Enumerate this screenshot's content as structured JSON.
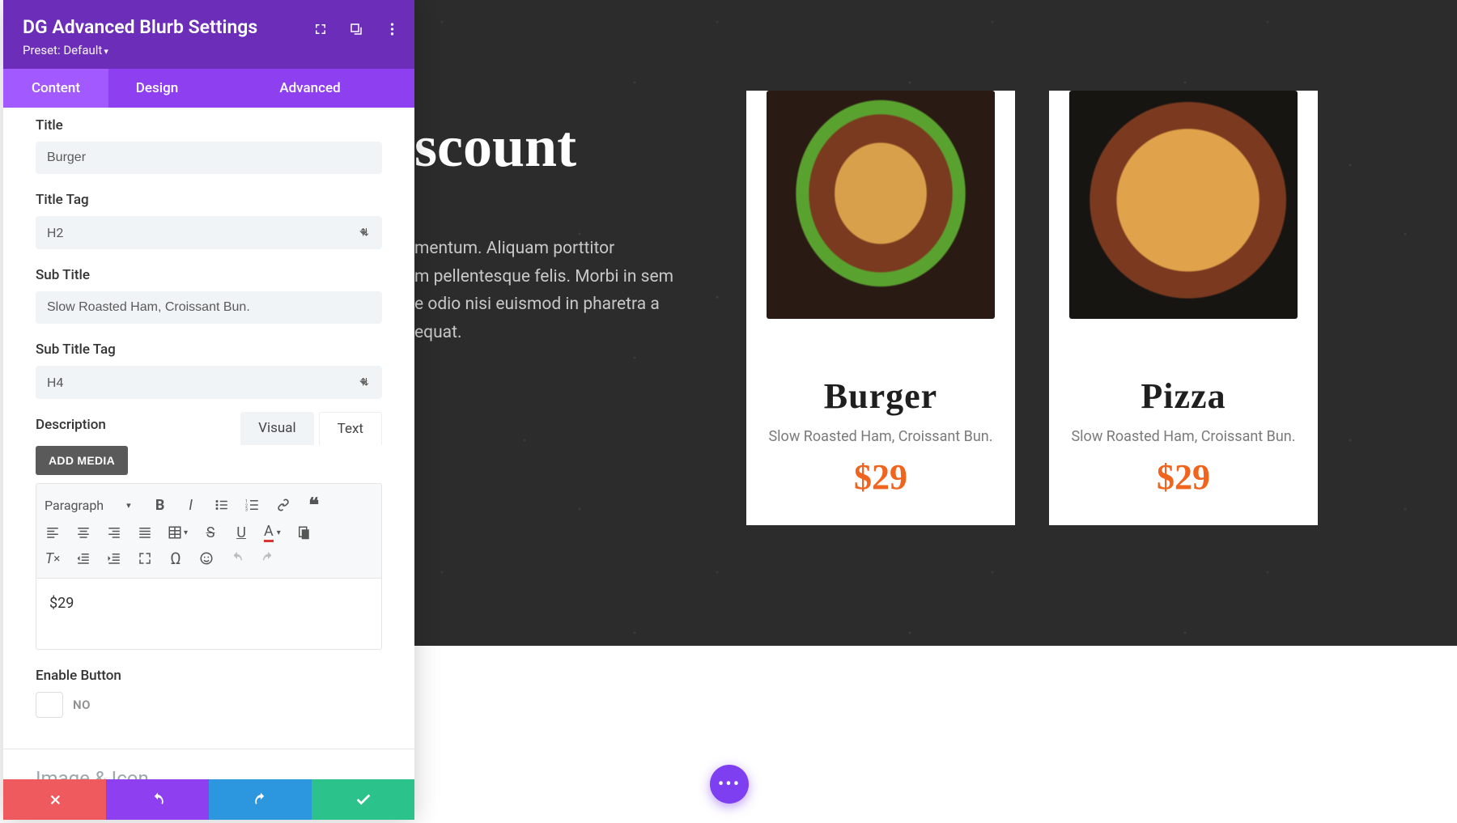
{
  "panel": {
    "title": "DG Advanced Blurb Settings",
    "preset_label": "Preset: Default",
    "tabs": [
      "Content",
      "Design",
      "Advanced"
    ],
    "fields": {
      "title_label": "Title",
      "title_value": "Burger",
      "title_tag_label": "Title Tag",
      "title_tag_value": "H2",
      "subtitle_label": "Sub Title",
      "subtitle_value": "Slow Roasted Ham, Croissant Bun.",
      "subtitle_tag_label": "Sub Title Tag",
      "subtitle_tag_value": "H4",
      "description_label": "Description",
      "add_media_btn": "ADD MEDIA",
      "editor_tabs": {
        "visual": "Visual",
        "text": "Text"
      },
      "paragraph_label": "Paragraph",
      "editor_content": "$29",
      "enable_button_label": "Enable Button",
      "enable_button_value": "NO",
      "section_image_icon": "Image & Icon"
    }
  },
  "preview": {
    "heading_fragment": "scount",
    "paragraph_fragment": "mentum. Aliquam porttitor\nm pellentesque felis. Morbi in sem\ne odio nisi euismod in pharetra a\nequat.",
    "cards": [
      {
        "title": "Burger",
        "subtitle": "Slow Roasted Ham, Croissant Bun.",
        "price": "$29",
        "img": "burger"
      },
      {
        "title": "Pizza",
        "subtitle": "Slow Roasted Ham, Croissant Bun.",
        "price": "$29",
        "img": "pizza"
      }
    ]
  },
  "fab": "•••"
}
